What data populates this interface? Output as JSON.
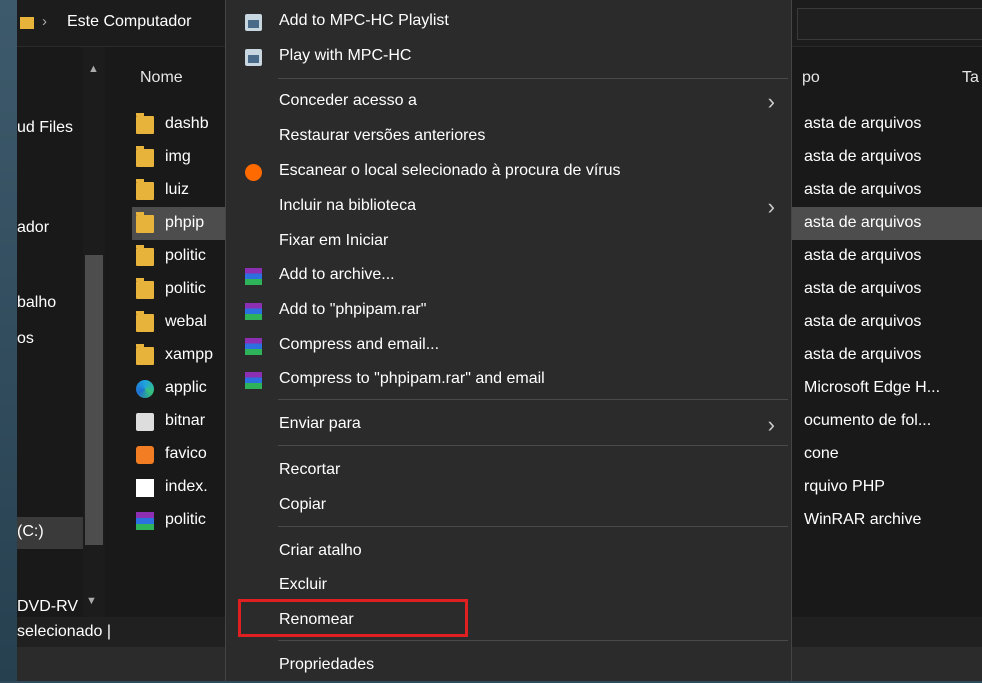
{
  "address_bar": {
    "separator": "›",
    "location": "Este Computador"
  },
  "nav": {
    "items": [
      "ud Files",
      "ador",
      "balho",
      "os",
      "(C:)",
      "DVD-RV"
    ]
  },
  "columns": {
    "name": "Nome",
    "type": "po",
    "size": "Ta"
  },
  "files": [
    {
      "name": "dashb",
      "type": "asta de arquivos",
      "icon": "folder-icon"
    },
    {
      "name": "img",
      "type": "asta de arquivos",
      "icon": "folder-icon"
    },
    {
      "name": "luiz",
      "type": "asta de arquivos",
      "icon": "folder-icon"
    },
    {
      "name": "phpip",
      "type": "asta de arquivos",
      "icon": "folder-icon",
      "selected": true
    },
    {
      "name": "politic",
      "type": "asta de arquivos",
      "icon": "folder-icon"
    },
    {
      "name": "politic",
      "type": "asta de arquivos",
      "icon": "folder-icon"
    },
    {
      "name": "webal",
      "type": "asta de arquivos",
      "icon": "folder-icon"
    },
    {
      "name": "xampp",
      "type": "asta de arquivos",
      "icon": "folder-icon"
    },
    {
      "name": "applic",
      "type": "Microsoft Edge H...",
      "icon": "edge-icon"
    },
    {
      "name": "bitnar",
      "type": "ocumento de fol...",
      "icon": "gear-file-icon"
    },
    {
      "name": "favico",
      "type": "cone",
      "icon": "xampp-icon"
    },
    {
      "name": "index.",
      "type": "rquivo PHP",
      "icon": "file-icon"
    },
    {
      "name": "politic",
      "type": "WinRAR archive",
      "icon": "winrar-icon"
    }
  ],
  "status": {
    "text": "selecionado  |"
  },
  "context_menu": {
    "items": [
      {
        "label": "Add to MPC-HC Playlist",
        "icon": "mpc-hc-icon"
      },
      {
        "label": "Play with MPC-HC",
        "icon": "mpc-hc-icon"
      },
      {
        "label": "Conceder acesso a",
        "submenu": true
      },
      {
        "label": "Restaurar versões anteriores"
      },
      {
        "label": "Escanear o local selecionado à procura de vírus",
        "icon": "avast-icon"
      },
      {
        "label": "Incluir na biblioteca",
        "submenu": true
      },
      {
        "label": "Fixar em Iniciar"
      },
      {
        "label": "Add to archive...",
        "icon": "winrar-icon"
      },
      {
        "label": "Add to \"phpipam.rar\"",
        "icon": "winrar-icon"
      },
      {
        "label": "Compress and email...",
        "icon": "winrar-icon"
      },
      {
        "label": "Compress to \"phpipam.rar\" and email",
        "icon": "winrar-icon"
      },
      {
        "label": "Enviar para",
        "submenu": true
      },
      {
        "label": "Recortar"
      },
      {
        "label": "Copiar"
      },
      {
        "label": "Criar atalho"
      },
      {
        "label": "Excluir"
      },
      {
        "label": "Renomear",
        "highlighted": true
      },
      {
        "label": "Propriedades"
      }
    ]
  },
  "colors": {
    "highlight_box": "#e02020",
    "folder": "#e8b33b",
    "menu_bg": "#2b2b2b"
  }
}
